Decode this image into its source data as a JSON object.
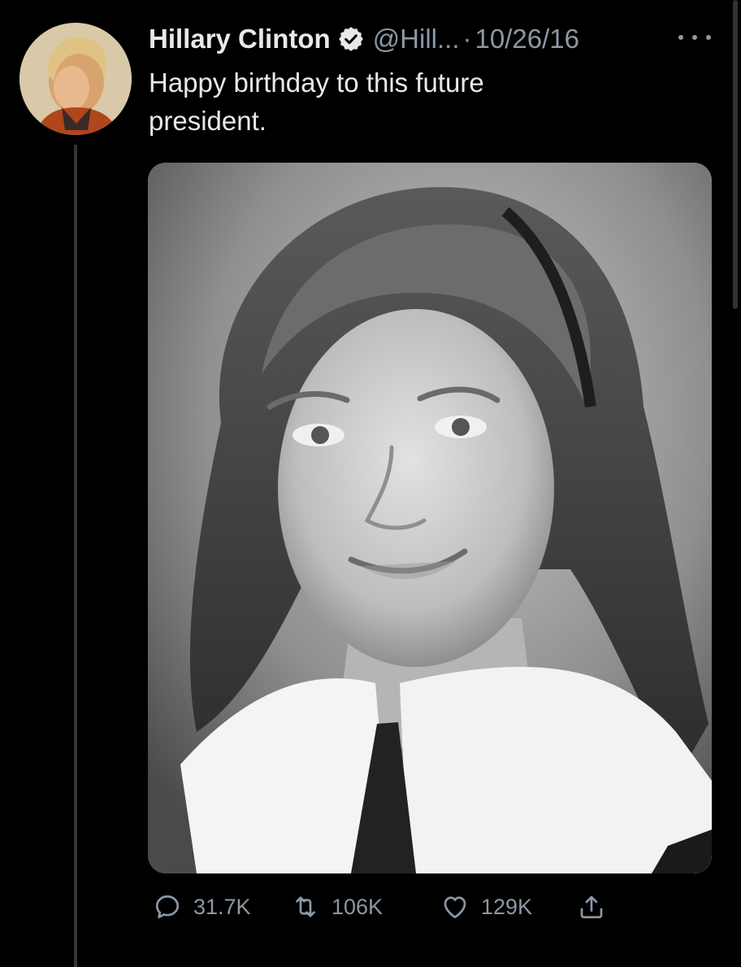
{
  "author": {
    "name": "Hillary Clinton",
    "handle": "@Hill...",
    "separator": "·",
    "date": "10/26/16"
  },
  "tweet": {
    "line1": "Happy birthday to this future",
    "line2": "president."
  },
  "actions": {
    "replies": "31.7K",
    "retweets": "106K",
    "likes": "129K"
  },
  "icons": {
    "verified": "verified-badge-icon",
    "more": "more-options-icon",
    "reply": "reply-icon",
    "retweet": "retweet-icon",
    "like": "heart-icon",
    "share": "share-icon"
  },
  "colors": {
    "background": "#000000",
    "text": "#e7e9ea",
    "muted": "#8b98a5",
    "thread_line": "#333639"
  }
}
